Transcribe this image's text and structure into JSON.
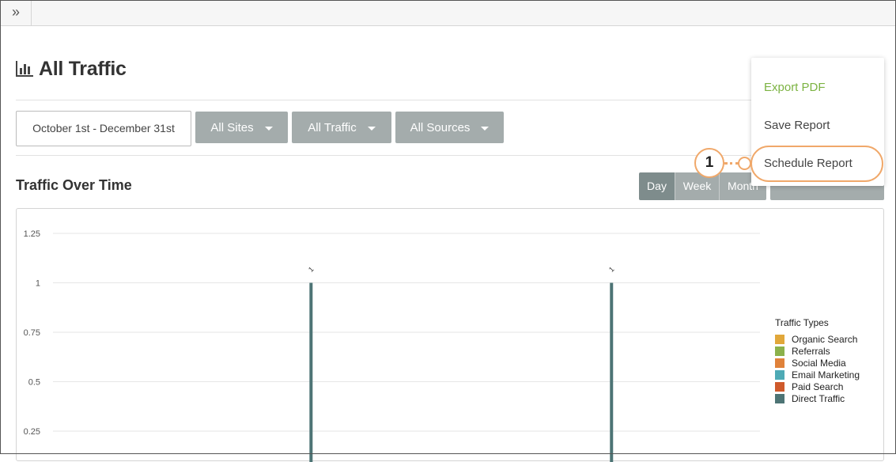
{
  "topbar": {
    "expand_icon": "double-chevron-right-icon",
    "expand_glyph": "»"
  },
  "page": {
    "title": "All Traffic",
    "title_icon": "bar-chart-icon"
  },
  "filters": {
    "date_range": "October 1st - December 31st",
    "sites": "All Sites",
    "traffic": "All Traffic",
    "sources": "All Sources"
  },
  "section": {
    "title": "Traffic Over Time"
  },
  "granularity": {
    "day": "Day",
    "week": "Week",
    "month": "Month",
    "selected": "Day"
  },
  "actions_menu": {
    "export": "Export PDF",
    "save": "Save Report",
    "schedule": "Schedule Report",
    "export_color": "#7cb342"
  },
  "callout": {
    "number": "1",
    "color": "#f0a86a"
  },
  "legend": {
    "title": "Traffic Types",
    "items": [
      {
        "label": "Organic Search",
        "color": "#e1a73a"
      },
      {
        "label": "Referrals",
        "color": "#8cb14b"
      },
      {
        "label": "Social Media",
        "color": "#e0823a"
      },
      {
        "label": "Email Marketing",
        "color": "#4eaab5"
      },
      {
        "label": "Paid Search",
        "color": "#cf5a2c"
      },
      {
        "label": "Direct Traffic",
        "color": "#4d7475"
      }
    ]
  },
  "chart_data": {
    "type": "bar",
    "title": "Traffic Over Time",
    "y_ticks": [
      "1.25",
      "1",
      "0.75",
      "0.5",
      "0.25"
    ],
    "ylim": [
      0,
      1.25
    ],
    "xlim": [
      0,
      1
    ],
    "grid": true,
    "series": [
      {
        "name": "Direct Traffic",
        "color": "#4d7475",
        "points": [
          {
            "x": 0.365,
            "y": 1,
            "label": "1"
          },
          {
            "x": 0.79,
            "y": 1,
            "label": "1"
          }
        ]
      }
    ]
  }
}
